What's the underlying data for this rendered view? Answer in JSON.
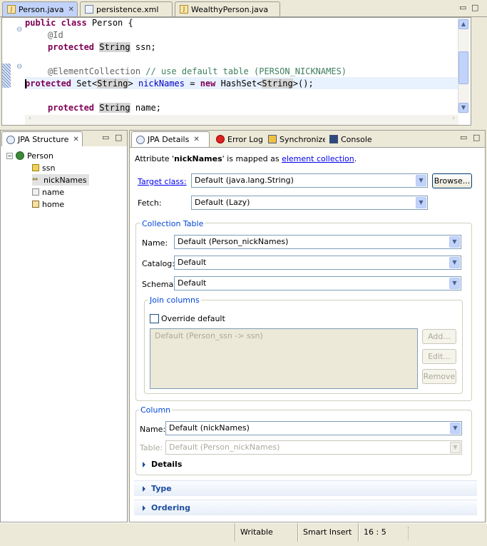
{
  "editor": {
    "tabs": [
      {
        "label": "Person.java"
      },
      {
        "label": "persistence.xml"
      },
      {
        "label": "WealthyPerson.java"
      }
    ],
    "code": {
      "l1_kw": "public class",
      "l1_rest": " Person {",
      "l2": "@Id",
      "l3_kw": "protected",
      "l3_type": "String",
      "l3_rest": " ssn;",
      "l5_ann": "@ElementCollection",
      "l5_cm": " // use default table (PERSON_NICKNAMES)",
      "l6_kw": "protected",
      "l6_a": " Set<",
      "l6_type1": "String",
      "l6_b": "> ",
      "l6_fld": "nickNames",
      "l6_c": " = ",
      "l6_new": "new",
      "l6_d": " HashSet<",
      "l6_type2": "String",
      "l6_e": ">();",
      "l8_kw": "protected",
      "l8_type": "String",
      "l8_rest": " name;"
    }
  },
  "structure": {
    "tab_label": "JPA Structure",
    "root": "Person",
    "items": [
      "ssn",
      "nickNames",
      "name",
      "home"
    ]
  },
  "details_tabs": [
    "JPA Details",
    "Error Log",
    "Synchronize",
    "Console"
  ],
  "details": {
    "intro_a": "Attribute '",
    "intro_attr": "nickNames",
    "intro_b": "' is mapped as ",
    "intro_link": "element collection",
    "intro_c": ".",
    "target_class_label": "Target class:",
    "target_class_value": "Default (java.lang.String)",
    "browse_label": "Browse...",
    "fetch_label": "Fetch:",
    "fetch_value": "Default (Lazy)",
    "collection_table": {
      "title": "Collection Table",
      "name_label": "Name:",
      "name_value": "Default (Person_nickNames)",
      "catalog_label": "Catalog:",
      "catalog_value": "Default",
      "schema_label": "Schema:",
      "schema_value": "Default",
      "join_columns_title": "Join columns",
      "override_label": "Override default",
      "join_list_item": "Default (Person_ssn -> ssn)",
      "add_label": "Add...",
      "edit_label": "Edit...",
      "remove_label": "Remove"
    },
    "column": {
      "title": "Column",
      "name_label": "Name:",
      "name_value": "Default (nickNames)",
      "table_label": "Table:",
      "table_value": "Default (Person_nickNames)",
      "details_label": "Details"
    },
    "type_section": "Type",
    "ordering_section": "Ordering"
  },
  "status": {
    "writable": "Writable",
    "insert_mode": "Smart Insert",
    "position": "16 : 5"
  }
}
